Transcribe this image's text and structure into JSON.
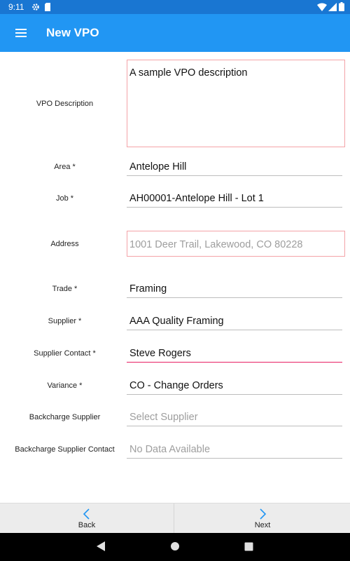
{
  "status_bar": {
    "time": "9:11",
    "icons": [
      "gear-icon",
      "sd-card-icon",
      "wifi-icon",
      "signal-icon",
      "battery-icon"
    ]
  },
  "app_bar": {
    "title": "New VPO",
    "menu_icon": "hamburger-menu-icon",
    "color": "#2196f3"
  },
  "form": {
    "vpo_description": {
      "label": "VPO Description",
      "value": "A sample VPO description"
    },
    "area": {
      "label": "Area *",
      "value": "Antelope Hill"
    },
    "job": {
      "label": "Job *",
      "value": "AH00001-Antelope Hill - Lot 1"
    },
    "address": {
      "label": "Address",
      "placeholder": "1001 Deer Trail, Lakewood, CO 80228"
    },
    "trade": {
      "label": "Trade *",
      "value": "Framing"
    },
    "supplier": {
      "label": "Supplier *",
      "value": "AAA Quality Framing"
    },
    "supplier_contact": {
      "label": "Supplier Contact *",
      "value": "Steve Rogers"
    },
    "variance": {
      "label": "Variance *",
      "value": "CO - Change Orders"
    },
    "backcharge_supplier": {
      "label": "Backcharge Supplier",
      "placeholder": "Select Supplier"
    },
    "backcharge_supplier_contact": {
      "label": "Backcharge Supplier Contact",
      "placeholder": "No Data Available"
    }
  },
  "bottom_nav": {
    "back_label": "Back",
    "next_label": "Next",
    "accent": "#2196f3"
  },
  "system_nav": {
    "icons": [
      "back-triangle-icon",
      "home-circle-icon",
      "recents-square-icon"
    ]
  },
  "colors": {
    "focus_underline": "#e91e63",
    "error_border": "#f4a3a8"
  }
}
